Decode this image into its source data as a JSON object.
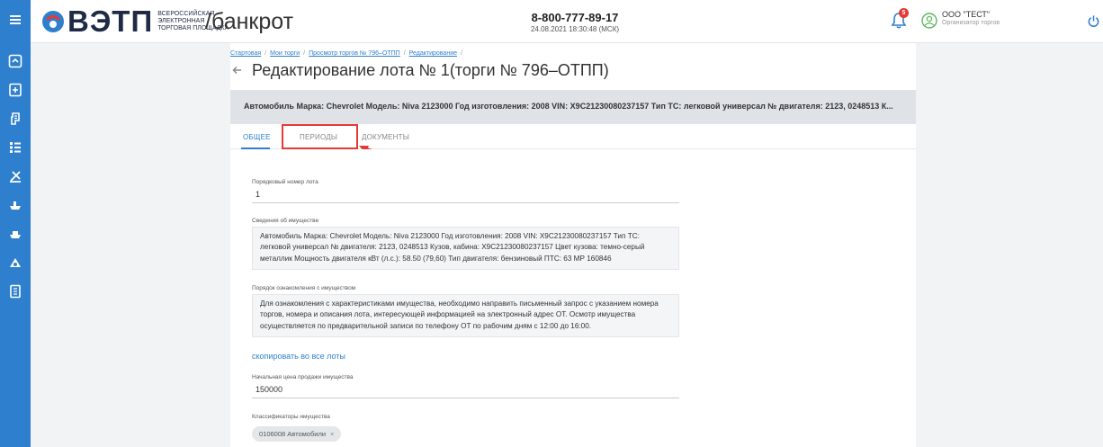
{
  "header": {
    "logo_word": "ВЭТП",
    "logo_sub_1": "ВСЕРОССИЙСКАЯ",
    "logo_sub_2": "ЭЛЕКТРОННАЯ",
    "logo_sub_3": "ТОРГОВАЯ ПЛОЩАДКА",
    "section": "/банкрот",
    "phone": "8-800-777-89-17",
    "datetime": "24.08.2021 18:30:48 (МСК)",
    "notification_count": "5",
    "user_name": "ООО \"ТЕСТ\"",
    "user_role": "Организатор торгов"
  },
  "breadcrumb": {
    "item1": "Стартовая",
    "item2": "Мои торги",
    "item3": "Просмотр торгов № 796–ОТПП",
    "item4": "Редактирование",
    "separator": "/"
  },
  "page": {
    "title": "Редактирование лота № 1(торги № 796–ОТПП)"
  },
  "lot": {
    "subject": "Автомобиль Марка: Chevrolet Модель: Niva 2123000 Год изготовления: 2008 VIN: X9C21230080237157 Тип ТС: легковой универсал № двигателя: 2123, 0248513 К..."
  },
  "tabs": {
    "general": "ОБЩЕЕ",
    "periods": "ПЕРИОДЫ",
    "documents": "ДОКУМЕНТЫ"
  },
  "form": {
    "lot_number_label": "Порядковый номер лота",
    "lot_number_value": "1",
    "property_info_label": "Сведения об имуществе",
    "property_info_value": "Автомобиль Марка: Chevrolet Модель: Niva 2123000 Год изготовления: 2008 VIN: X9C21230080237157 Тип ТС: легковой универсал № двигателя: 2123, 0248513 Кузов, кабина: X9C21230080237157 Цвет кузова: темно-серый металлик Мощность двигателя кВт (л.с.): 58.50 (79,60) Тип двигателя: бензиновый ПТС: 63 МР 160846",
    "inspection_label": "Порядок ознакомления с имуществом",
    "inspection_value": "Для ознакомления с характеристиками имущества, необходимо направить письменный запрос с указанием номера торгов, номера и описания лота, интересующей информацией на электронный адрес ОТ. Осмотр имущества осуществляется по предварительной записи по телефону ОТ по рабочим дням с 12:00 до 16:00.",
    "copy_link": "скопировать во все лоты",
    "start_price_label": "Начальная цена продажи имущества",
    "start_price_value": "150000",
    "classifiers_label": "Классификаторы имущества",
    "classifier_chip": "0106008 Автомобили",
    "chip_remove": "×"
  },
  "icons": {
    "sidebar": [
      "menu-icon",
      "home-icon",
      "plus-box-icon",
      "gavel-icon",
      "list-icon",
      "scale-icon",
      "ship-icon",
      "ship2-icon",
      "building-icon",
      "book-icon"
    ]
  },
  "colors": {
    "sidebar": "#2f7fcf",
    "accent": "#2f7fcf",
    "highlight": "#e53935",
    "badge": "#e53935"
  }
}
